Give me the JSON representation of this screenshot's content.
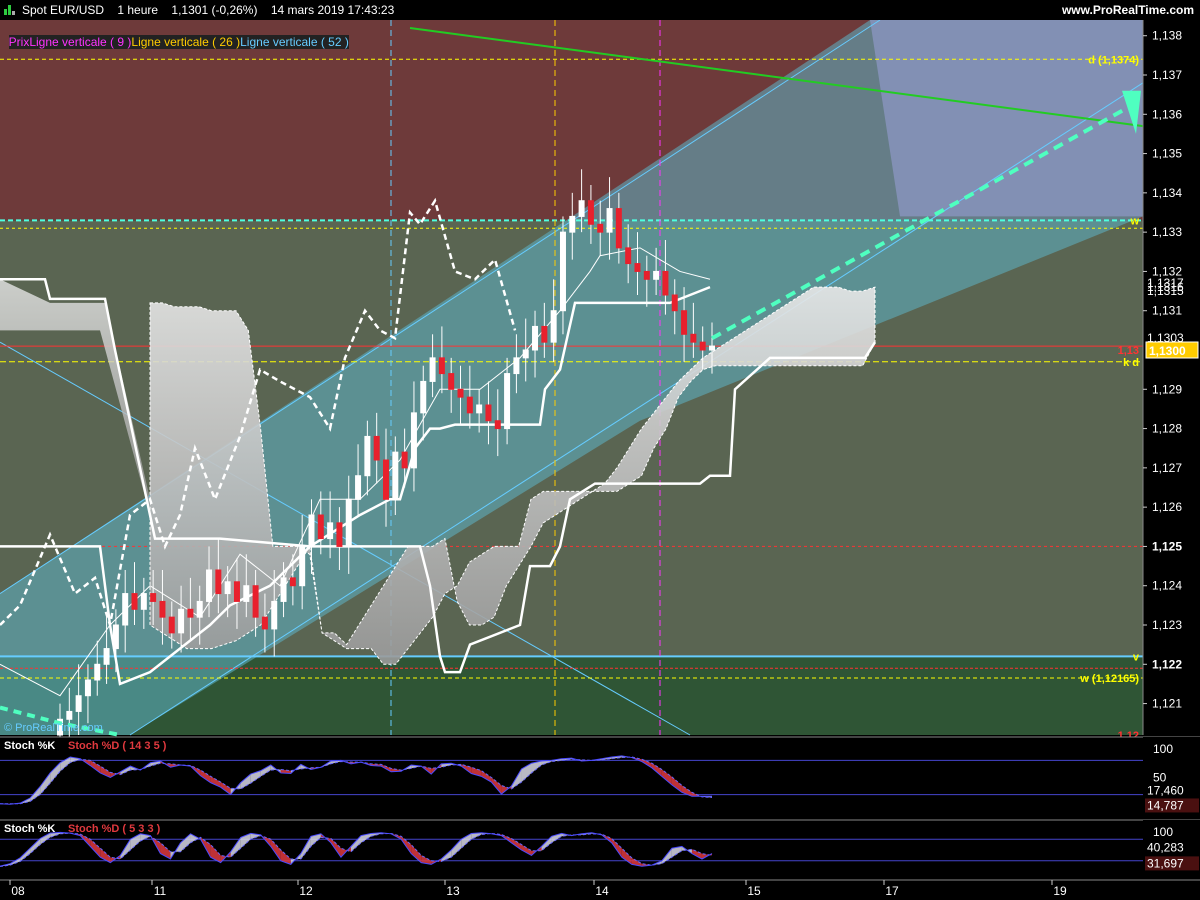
{
  "header": {
    "instrument": "Spot EUR/USD",
    "timeframe": "1 heure",
    "quote": "1,1301 (-0,26%)",
    "datetime": "14 mars 2019 17:43:23",
    "site": "www.ProRealTime.com"
  },
  "legend": [
    {
      "label": "Prix",
      "color": "#ff33ff"
    },
    {
      "label": "Ligne verticale ( 9 )",
      "color": "#ff33ff"
    },
    {
      "label": "Ligne verticale ( 26 )",
      "color": "#ffcc00"
    },
    {
      "label": "Ligne verticale ( 52 )",
      "color": "#66ccff"
    }
  ],
  "watermark": "© ProRealTime.com",
  "price_axis": {
    "ticks": [
      "1,138",
      "1,137",
      "1,136",
      "1,135",
      "1,134",
      "1,133",
      "1,132",
      "1,131",
      "1,129",
      "1,128",
      "1,127",
      "1,126",
      "1,125",
      "1,124",
      "1,123",
      "1,122",
      "1,121"
    ],
    "labels": [
      {
        "text": "1,1317",
        "price": 1.1317
      },
      {
        "text": "1,1316",
        "price": 1.1316
      },
      {
        "text": "1,1315",
        "price": 1.1315
      },
      {
        "text": "1,1303",
        "price": 1.1303
      }
    ],
    "current": "1,1300",
    "current_price": 1.13
  },
  "levels": [
    {
      "label": "d (1,1374)",
      "price": 1.1374,
      "color": "#ffff00"
    },
    {
      "label": "w",
      "price": 1.1333,
      "color": "#ffff00"
    },
    {
      "label": "k d",
      "price": 1.1297,
      "color": "#ffff00"
    },
    {
      "label": "1,13",
      "price": 1.13,
      "color": "#ff3333"
    },
    {
      "label": "v",
      "price": 1.1222,
      "color": "#ffff00"
    },
    {
      "label": "w (1,12165)",
      "price": 1.12165,
      "color": "#ffff00"
    },
    {
      "label": "1,12",
      "price": 1.1202,
      "color": "#ff3333"
    }
  ],
  "time_axis": [
    "08",
    "11",
    "12",
    "13",
    "14",
    "15",
    "17",
    "19"
  ],
  "stoch1": {
    "label_k": "Stoch %K",
    "label_d": "Stoch %D ( 14 3 5 )",
    "axis": [
      "100",
      "50"
    ],
    "value_k": "17,460",
    "value_d": "14,787",
    "k_values": [
      4,
      3,
      5,
      14,
      34,
      58,
      76,
      86,
      83,
      71,
      58,
      50,
      60,
      70,
      63,
      76,
      79,
      68,
      72,
      70,
      53,
      41,
      33,
      20,
      41,
      56,
      62,
      72,
      58,
      57,
      73,
      64,
      68,
      79,
      80,
      74,
      77,
      71,
      70,
      60,
      61,
      72,
      70,
      56,
      74,
      75,
      70,
      57,
      52,
      42,
      21,
      35,
      65,
      75,
      79,
      80,
      83,
      84,
      79,
      80,
      83,
      86,
      88,
      85,
      78,
      67,
      52,
      37,
      24,
      17,
      17,
      17
    ],
    "d_values": [
      4,
      4,
      4,
      8,
      20,
      40,
      61,
      76,
      82,
      80,
      70,
      59,
      55,
      63,
      64,
      70,
      75,
      74,
      72,
      71,
      63,
      52,
      42,
      31,
      30,
      40,
      52,
      63,
      64,
      62,
      65,
      67,
      68,
      74,
      78,
      77,
      77,
      74,
      73,
      66,
      63,
      66,
      70,
      66,
      68,
      72,
      73,
      68,
      62,
      50,
      36,
      30,
      42,
      58,
      72,
      78,
      80,
      82,
      81,
      80,
      81,
      83,
      85,
      86,
      82,
      75,
      64,
      51,
      36,
      24,
      16,
      15
    ]
  },
  "stoch2": {
    "label_k": "Stoch %K",
    "label_d": "Stoch %D ( 5 3 3 )",
    "axis": [
      "100"
    ],
    "value_k": "40,283",
    "value_d": "31,697",
    "k_values": [
      5,
      12,
      28,
      55,
      82,
      97,
      99,
      97,
      90,
      60,
      30,
      15,
      35,
      80,
      95,
      90,
      40,
      25,
      70,
      95,
      80,
      30,
      15,
      45,
      85,
      96,
      92,
      60,
      20,
      10,
      40,
      88,
      95,
      70,
      30,
      60,
      90,
      96,
      98,
      95,
      80,
      40,
      15,
      10,
      25,
      50,
      80,
      96,
      98,
      95,
      90,
      70,
      50,
      35,
      60,
      88,
      96,
      90,
      95,
      98,
      92,
      70,
      30,
      10,
      5,
      8,
      20,
      55,
      60,
      40,
      25,
      40
    ],
    "d_values": [
      4,
      8,
      18,
      40,
      65,
      85,
      95,
      97,
      94,
      80,
      55,
      30,
      25,
      50,
      75,
      88,
      70,
      45,
      45,
      70,
      85,
      65,
      35,
      30,
      55,
      80,
      90,
      80,
      50,
      25,
      25,
      60,
      85,
      82,
      55,
      45,
      70,
      88,
      95,
      96,
      88,
      65,
      35,
      20,
      18,
      30,
      55,
      80,
      93,
      96,
      93,
      82,
      65,
      48,
      48,
      70,
      88,
      92,
      92,
      95,
      94,
      82,
      55,
      28,
      12,
      8,
      12,
      30,
      48,
      52,
      40,
      35
    ]
  },
  "chart_data": [
    {
      "type": "candlestick",
      "title": "Spot EUR/USD",
      "subtitle": "1 heure",
      "ylim": [
        1.1202,
        1.1384
      ],
      "x_tick_labels": [
        "08",
        "11",
        "12",
        "13",
        "14",
        "15",
        "17",
        "19"
      ],
      "close_series": [
        1.1206,
        1.1208,
        1.1212,
        1.1216,
        1.122,
        1.1224,
        1.123,
        1.1238,
        1.1234,
        1.1238,
        1.1236,
        1.1232,
        1.1228,
        1.1234,
        1.1232,
        1.1236,
        1.1244,
        1.1238,
        1.1241,
        1.1236,
        1.124,
        1.1232,
        1.1229,
        1.1236,
        1.1242,
        1.124,
        1.125,
        1.1258,
        1.1252,
        1.1256,
        1.125,
        1.1262,
        1.1268,
        1.1278,
        1.1272,
        1.1262,
        1.1274,
        1.127,
        1.1284,
        1.1292,
        1.1298,
        1.1294,
        1.129,
        1.1288,
        1.1284,
        1.1286,
        1.1282,
        1.128,
        1.1294,
        1.1298,
        1.13,
        1.1306,
        1.1302,
        1.131,
        1.133,
        1.1334,
        1.1338,
        1.1332,
        1.133,
        1.1336,
        1.1326,
        1.1322,
        1.132,
        1.1318,
        1.132,
        1.1314,
        1.131,
        1.1304,
        1.1302,
        1.13,
        1.1301
      ],
      "cloud_upper": [
        1.1312,
        1.1312,
        1.1311,
        1.1311,
        1.1311,
        1.131,
        1.131,
        1.131,
        1.1305,
        1.128,
        1.125,
        1.125,
        1.125,
        1.1248,
        1.1228,
        1.1228,
        1.1225,
        1.123,
        1.1235,
        1.124,
        1.1245,
        1.125,
        1.125,
        1.125,
        1.1252,
        1.1236,
        1.123,
        1.123,
        1.1232,
        1.124,
        1.1245,
        1.125,
        1.1256,
        1.1258,
        1.126,
        1.1262,
        1.1264,
        1.1266,
        1.127,
        1.1275,
        1.128,
        1.1284,
        1.1288,
        1.1292,
        1.1295,
        1.1298,
        1.13,
        1.1302,
        1.1304,
        1.1306,
        1.1308,
        1.131,
        1.1312,
        1.1314,
        1.1316,
        1.1316,
        1.1316,
        1.1315,
        1.1315,
        1.1316
      ],
      "cloud_lower": [
        1.123,
        1.1228,
        1.1226,
        1.1224,
        1.1224,
        1.1224,
        1.1225,
        1.1226,
        1.1228,
        1.123,
        1.1235,
        1.124,
        1.1245,
        1.125,
        1.1228,
        1.1226,
        1.1224,
        1.1224,
        1.1224,
        1.122,
        1.122,
        1.1224,
        1.1228,
        1.1232,
        1.1238,
        1.124,
        1.1246,
        1.1248,
        1.125,
        1.125,
        1.125,
        1.1262,
        1.1264,
        1.1264,
        1.1264,
        1.1264,
        1.1264,
        1.1264,
        1.1264,
        1.1266,
        1.1268,
        1.1275,
        1.128,
        1.1288,
        1.1292,
        1.1295,
        1.1296,
        1.1296,
        1.1296,
        1.1296,
        1.1296,
        1.1296,
        1.1296,
        1.1296,
        1.1296,
        1.1296,
        1.1296,
        1.1296,
        1.1296,
        1.1302
      ]
    },
    {
      "type": "line",
      "title": "Stoch %K / Stoch %D ( 14 3 5 )",
      "ylim": [
        0,
        100
      ]
    },
    {
      "type": "line",
      "title": "Stoch %K / Stoch %D ( 5 3 3 )",
      "ylim": [
        0,
        100
      ]
    }
  ]
}
